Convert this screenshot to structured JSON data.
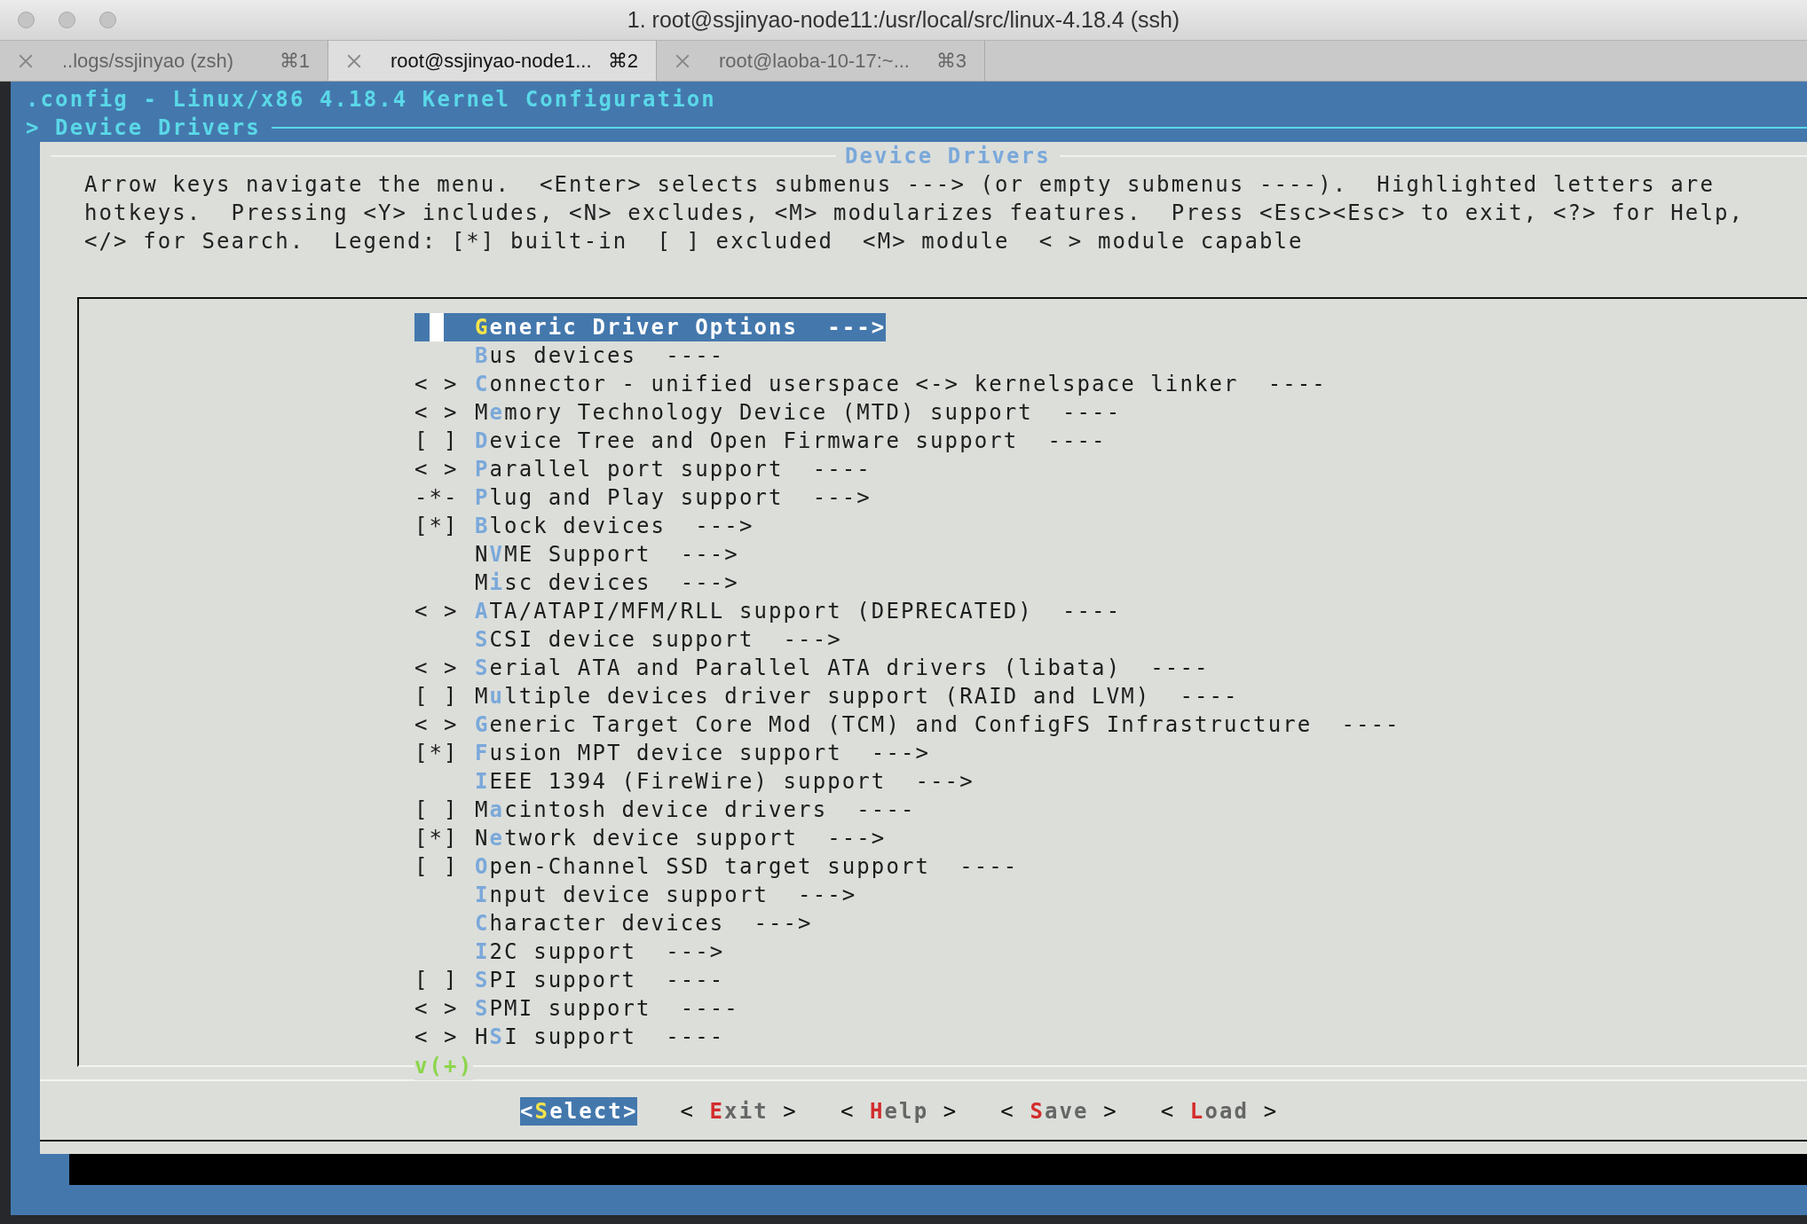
{
  "window": {
    "title": "1. root@ssjinyao-node11:/usr/local/src/linux-4.18.4 (ssh)"
  },
  "tabs": [
    {
      "label": "..logs/ssjinyao (zsh)",
      "shortcut": "⌘1",
      "selected": false
    },
    {
      "label": "root@ssjinyao-node1...",
      "shortcut": "⌘2",
      "selected": true
    },
    {
      "label": "root@laoba-10-17:~...",
      "shortcut": "⌘3",
      "selected": false
    }
  ],
  "header": {
    "title": ".config - Linux/x86 4.18.4 Kernel Configuration",
    "breadcrumb": "> Device Drivers"
  },
  "dialog": {
    "title": "Device Drivers",
    "help": "Arrow keys navigate the menu.  <Enter> selects submenus ---> (or empty submenus ----).  Highlighted letters are\nhotkeys.  Pressing <Y> includes, <N> excludes, <M> modularizes features.  Press <Esc><Esc> to exit, <?> for Help,\n</> for Search.  Legend: [*] built-in  [ ] excluded  <M> module  < > module capable",
    "items": [
      {
        "key": "G",
        "rest": "eneric Driver Options  --->",
        "selected": true
      },
      {
        "key": "B",
        "rest": "us devices  ----",
        "selected": false
      },
      {
        "prefix": "< >",
        "key": "C",
        "rest": "onnector - unified userspace <-> kernelspace linker  ----",
        "selected": false
      },
      {
        "prefix": "< >",
        "lead": "M",
        "key": "e",
        "rest": "mory Technology Device (MTD) support  ----",
        "selected": false
      },
      {
        "prefix": "[ ]",
        "key": "D",
        "rest": "evice Tree and Open Firmware support  ----",
        "selected": false
      },
      {
        "prefix": "< >",
        "key": "P",
        "rest": "arallel port support  ----",
        "selected": false
      },
      {
        "prefix": "-*-",
        "key": "P",
        "rest": "lug and Play support  --->",
        "selected": false
      },
      {
        "prefix": "[*]",
        "key": "B",
        "rest": "lock devices  --->",
        "selected": false
      },
      {
        "lead": "N",
        "key": "V",
        "rest": "ME Support  --->",
        "selected": false
      },
      {
        "lead": "M",
        "key": "i",
        "rest": "sc devices  --->",
        "selected": false
      },
      {
        "prefix": "< >",
        "key": "A",
        "rest": "TA/ATAPI/MFM/RLL support (DEPRECATED)  ----",
        "selected": false
      },
      {
        "key": "S",
        "rest": "CSI device support  --->",
        "selected": false
      },
      {
        "prefix": "< >",
        "key": "S",
        "rest": "erial ATA and Parallel ATA drivers (libata)  ----",
        "selected": false
      },
      {
        "prefix": "[ ]",
        "lead": "M",
        "key": "u",
        "rest": "ltiple devices driver support (RAID and LVM)  ----",
        "selected": false
      },
      {
        "prefix": "< >",
        "key": "G",
        "rest": "eneric Target Core Mod (TCM) and ConfigFS Infrastructure  ----",
        "selected": false
      },
      {
        "prefix": "[*]",
        "key": "F",
        "rest": "usion MPT device support  --->",
        "selected": false
      },
      {
        "key": "I",
        "rest": "EEE 1394 (FireWire) support  --->",
        "selected": false
      },
      {
        "prefix": "[ ]",
        "lead": "M",
        "key": "a",
        "rest": "cintosh device drivers  ----",
        "selected": false
      },
      {
        "prefix": "[*]",
        "lead": "N",
        "key": "e",
        "rest": "twork device support  --->",
        "selected": false
      },
      {
        "prefix": "[ ]",
        "key": "O",
        "rest": "pen-Channel SSD target support  ----",
        "selected": false
      },
      {
        "key": "I",
        "rest": "nput device support  --->",
        "selected": false
      },
      {
        "key": "C",
        "rest": "haracter devices  --->",
        "selected": false
      },
      {
        "key": "I",
        "rest": "2C support  --->",
        "selected": false
      },
      {
        "prefix": "[ ]",
        "key": "S",
        "rest": "PI support  ----",
        "selected": false
      },
      {
        "prefix": "< >",
        "key": "S",
        "rest": "PMI support  ----",
        "selected": false
      },
      {
        "prefix": "< >",
        "lead": "H",
        "key": "S",
        "rest": "I support  ----",
        "selected": false
      }
    ],
    "more": "v(+)",
    "buttons": [
      {
        "open": "<",
        "key": "S",
        "rest": "elect",
        "close": ">",
        "selected": true
      },
      {
        "open": "< ",
        "key": "E",
        "rest": "xit",
        "close": " >",
        "selected": false
      },
      {
        "open": "< ",
        "key": "H",
        "rest": "elp",
        "close": " >",
        "selected": false
      },
      {
        "open": "< ",
        "key": "S",
        "rest": "ave",
        "close": " >",
        "selected": false
      },
      {
        "open": "< ",
        "key": "L",
        "rest": "oad",
        "close": " >",
        "selected": false
      }
    ]
  }
}
